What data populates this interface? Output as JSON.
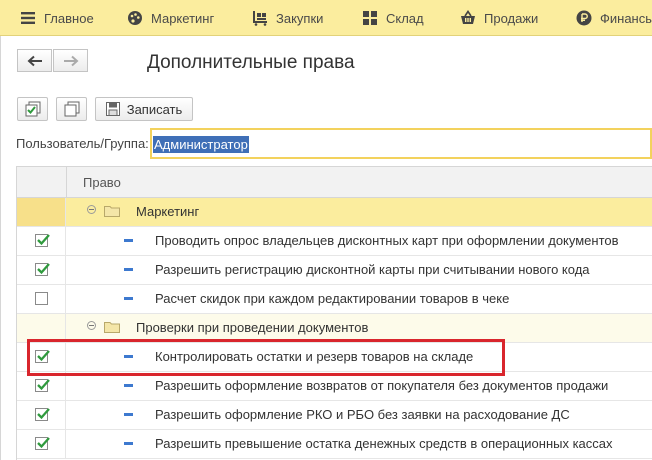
{
  "menu": {
    "items": [
      {
        "label": "Главное",
        "icon": "hamburger-icon"
      },
      {
        "label": "Маркетинг",
        "icon": "palette-icon"
      },
      {
        "label": "Закупки",
        "icon": "trolley-icon"
      },
      {
        "label": "Склад",
        "icon": "grid-icon"
      },
      {
        "label": "Продажи",
        "icon": "basket-icon"
      },
      {
        "label": "Финансы",
        "icon": "ruble-icon"
      }
    ]
  },
  "window": {
    "title": "Дополнительные права",
    "nav": {
      "back_icon": "arrow-left-icon",
      "forward_icon": "arrow-right-icon"
    },
    "toolbar": {
      "save_label": "Записать"
    }
  },
  "user": {
    "label": "Пользователь/Группа:",
    "value": "Администратор"
  },
  "table": {
    "header": "Право",
    "rows": [
      {
        "type": "group",
        "label": "Маркетинг"
      },
      {
        "type": "item",
        "checked": true,
        "label": "Проводить опрос владельцев дисконтных карт при оформлении документов"
      },
      {
        "type": "item",
        "checked": true,
        "label": "Разрешить регистрацию дисконтной карты при считывании нового кода"
      },
      {
        "type": "item",
        "checked": false,
        "label": "Расчет скидок при каждом редактировании товаров в чеке"
      },
      {
        "type": "group",
        "label": "Проверки при проведении документов"
      },
      {
        "type": "item",
        "checked": true,
        "label": "Контролировать остатки и резерв товаров на складе"
      },
      {
        "type": "item",
        "checked": true,
        "label": "Разрешить оформление возвратов от покупателя без документов продажи"
      },
      {
        "type": "item",
        "checked": true,
        "label": "Разрешить оформление РКО и РБО без заявки на расходование ДС"
      },
      {
        "type": "item",
        "checked": true,
        "label": "Разрешить превышение остатка денежных средств в операционных кассах"
      }
    ]
  },
  "colors": {
    "menu_bg": "#fbed9e",
    "selection": "#3f6fb7",
    "highlight_border": "#d9262d",
    "check": "#2f9a3d"
  }
}
